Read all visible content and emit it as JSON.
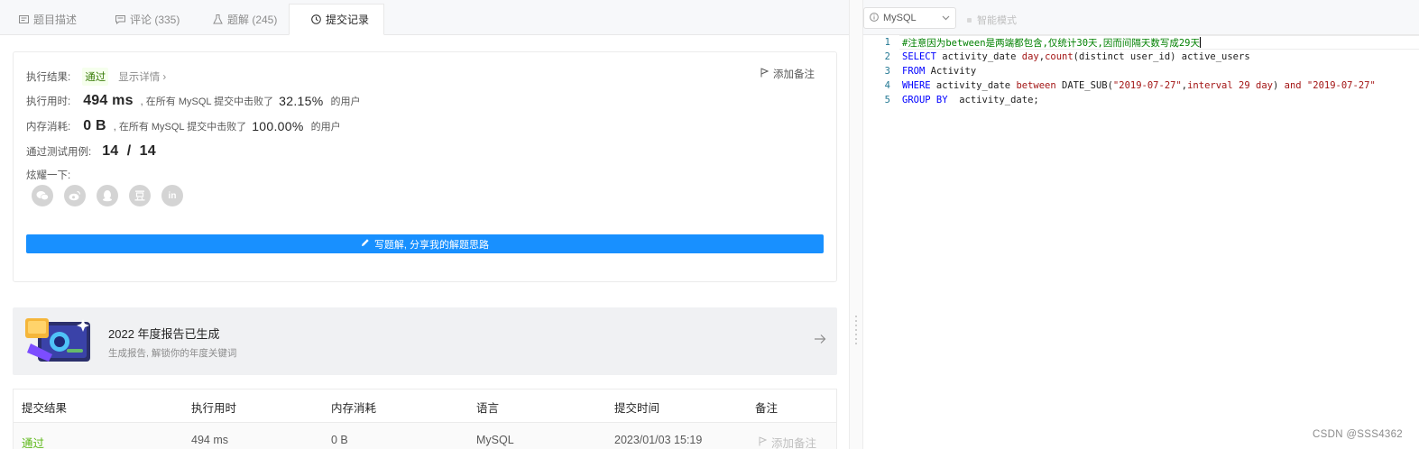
{
  "tabs": [
    {
      "label": "题目描述",
      "icon": "description-icon"
    },
    {
      "label": "评论 (335)",
      "icon": "comment-icon"
    },
    {
      "label": "题解 (245)",
      "icon": "flask-icon"
    },
    {
      "label": "提交记录",
      "icon": "clock-icon",
      "active": true
    }
  ],
  "result": {
    "status_label": "执行结果:",
    "status_value": "通过",
    "detail_link": "显示详情 ›",
    "add_note": "添加备注",
    "runtime_label": "执行用时:",
    "runtime_value": "494 ms",
    "runtime_beat": ", 在所有 MySQL 提交中击败了",
    "runtime_pct": "32.15%",
    "runtime_suffix": "的用户",
    "memory_label": "内存消耗:",
    "memory_value": "0 B",
    "memory_beat": ", 在所有 MySQL 提交中击败了",
    "memory_pct": "100.00%",
    "memory_suffix": "的用户",
    "tests_label": "通过测试用例:",
    "tests_value": "14  /  14",
    "share_label": "炫耀一下:",
    "share_icons": [
      "wechat-icon",
      "weibo-icon",
      "qq-icon",
      "douban-icon",
      "linkedin-icon"
    ],
    "write_solution": "写题解, 分享我的解题思路"
  },
  "banner": {
    "title": "2022 年度报告已生成",
    "subtitle": "生成报告, 解锁你的年度关键词"
  },
  "submissions": {
    "headers": [
      "提交结果",
      "执行用时",
      "内存消耗",
      "语言",
      "提交时间",
      "备注"
    ],
    "rows": [
      {
        "result": "通过",
        "runtime": "494 ms",
        "memory": "0 B",
        "language": "MySQL",
        "time": "2023/01/03 15:19",
        "note": "添加备注"
      }
    ]
  },
  "editor": {
    "language": "MySQL",
    "smart_mode": "智能模式",
    "lines": [
      {
        "n": "1",
        "text": "#注意因为between是两端都包含,仅统计30天,因而间隔天数写成29天"
      },
      {
        "n": "2",
        "text": "SELECT activity_date day,count(distinct user_id) active_users"
      },
      {
        "n": "3",
        "text": "FROM Activity"
      },
      {
        "n": "4",
        "text": "WHERE activity_date between DATE_SUB(\"2019-07-27\",interval 29 day) and \"2019-07-27\""
      },
      {
        "n": "5",
        "text": "GROUP BY  activity_date;"
      }
    ]
  },
  "watermark": "CSDN @SSS4362",
  "colors": {
    "accent": "#1890ff",
    "pass": "#5db818",
    "banner_bg": "#f0f1f3"
  }
}
